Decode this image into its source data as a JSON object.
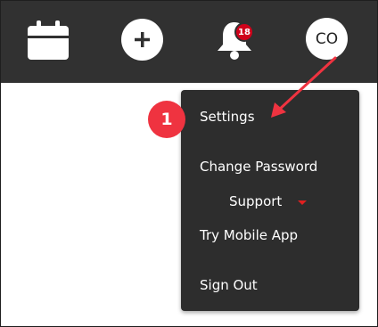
{
  "topbar": {
    "icons": [
      "calendar-icon",
      "plus-icon",
      "bell-icon"
    ],
    "notification_count": "18",
    "avatar_initials": "CO"
  },
  "menu": {
    "items": [
      {
        "label": "Settings"
      },
      {
        "label": "Change Password"
      },
      {
        "label": "Support"
      },
      {
        "label": "Try Mobile App"
      },
      {
        "label": "Sign Out"
      }
    ]
  },
  "annotation": {
    "step_number": "1",
    "color": "#ef3340"
  },
  "colors": {
    "topbar": "#313131",
    "menu_bg": "#2d2d2d",
    "badge": "#d0021b"
  }
}
